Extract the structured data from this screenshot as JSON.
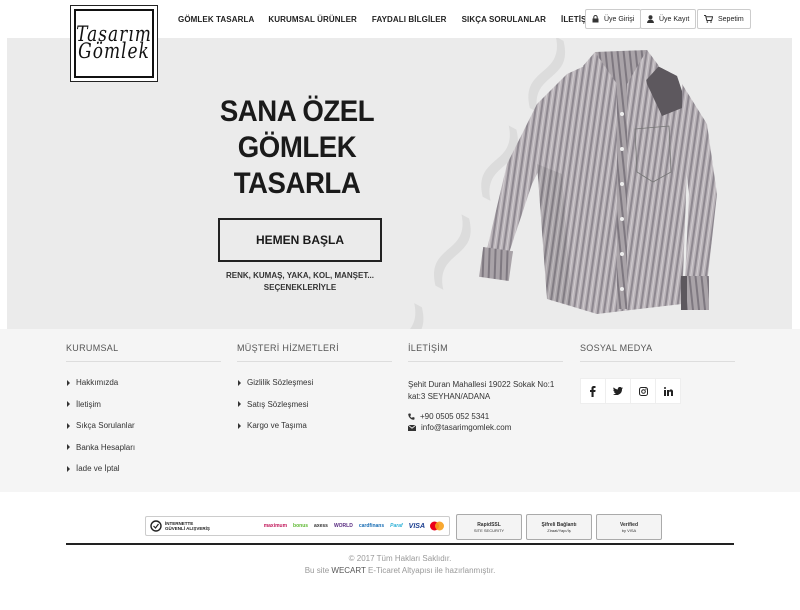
{
  "logo": {
    "line1": "Tasarım",
    "line2": "Gömlek"
  },
  "nav": {
    "items": [
      "GÖMLEK TASARLA",
      "KURUMSAL ÜRÜNLER",
      "FAYDALI BİLGİLER",
      "SIKÇA SORULANLAR",
      "İLETİŞİM"
    ]
  },
  "account": {
    "login": "Üye Girişi",
    "register": "Üye Kayıt",
    "cart": "Sepetim"
  },
  "hero": {
    "title_line1": "SANA ÖZEL",
    "title_line2": "GÖMLEK",
    "title_line3": "TASARLA",
    "button": "HEMEN BAŞLA",
    "sub_line1": "RENK, KUMAŞ, YAKA, KOL, MANŞET...",
    "sub_line2": "SEÇENEKLERİYLE"
  },
  "footer": {
    "kurumsal": {
      "title": "KURUMSAL",
      "items": [
        "Hakkımızda",
        "İletişim",
        "Sıkça Sorulanlar",
        "Banka Hesapları",
        "İade ve İptal"
      ]
    },
    "musteri": {
      "title": "MÜŞTERİ HİZMETLERİ",
      "items": [
        "Gizlilik Sözleşmesi",
        "Satış Sözleşmesi",
        "Kargo ve Taşıma"
      ]
    },
    "iletisim": {
      "title": "İLETİŞİM",
      "address_line1": "Şehit Duran Mahallesi 19022 Sokak No:1",
      "address_line2": "kat:3 SEYHAN/ADANA",
      "phone": "+90 0505 052 5341",
      "email": "info@tasarimgomlek.com"
    },
    "sosyal": {
      "title": "SOSYAL MEDYA"
    }
  },
  "badges": {
    "secure_line1": "İNTERNETTE",
    "secure_line2": "GÜVENLİ ALIŞVERİŞ",
    "brands": [
      "maximum",
      "bonus",
      "axess",
      "WORLD",
      "cardfinans",
      "Paraf",
      "VISA"
    ],
    "rapidssl": "RapidSSL",
    "rapidssl_sub": "SITE SECURITY",
    "sifreli": "Şifreli Bağlantı",
    "sifreli_sub": "Ziraat/Yapı/İş",
    "visa_verified": "Verified",
    "visa_by": "by VISA"
  },
  "copyright": {
    "line1": "© 2017 Tüm Hakları Saklıdır.",
    "line2_pre": "Bu site",
    "line2_brand": "WECART",
    "line2_post": "E-Ticaret Altyapısı ile hazırlanmıştır."
  },
  "colors": {
    "accent": "#222222",
    "hero_bg": "#ebebeb",
    "footer_bg": "#f5f5f5"
  }
}
